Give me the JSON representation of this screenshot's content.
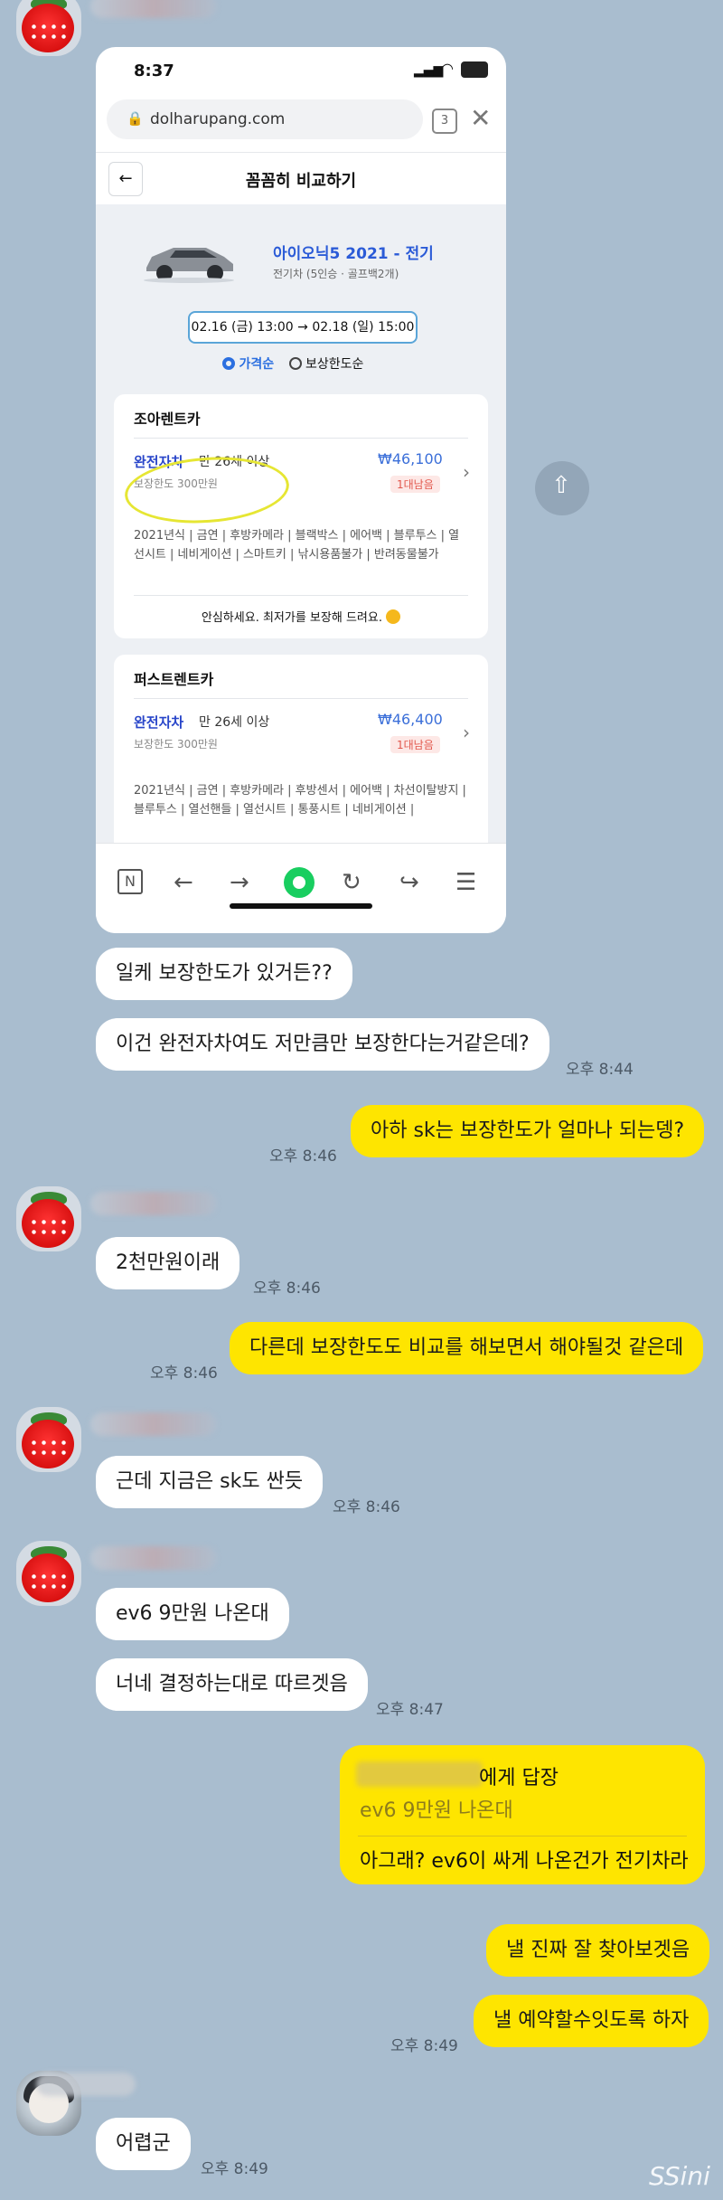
{
  "phone": {
    "status_time": "8:37",
    "tab_count": "3",
    "url": "dolharupang.com",
    "page_title": "꼼꼼히 비교하기",
    "car_name": "아이오닉5 2021 - 전기",
    "car_specs": "전기차 (5인승 · 골프백2개)",
    "date_from": "02.16 (금) 13:00",
    "date_arrow": "→",
    "date_to": "02.18 (일) 15:00",
    "sort_price": "가격순",
    "sort_coverage": "보상한도순",
    "companies": [
      {
        "name": "조아렌트카",
        "insurance": "완전자차",
        "age": "만 26세 이상",
        "price": "₩46,100",
        "badge": "1대남음",
        "limit": "보장한도 300만원",
        "options": "2021년식 | 금연 | 후방카메라 | 블랙박스 | 에어백 | 블루투스 | 열선시트 | 네비게이션 | 스마트키 | 낚시용품불가 | 반려동물불가",
        "notice": "안심하세요. 최저가를 보장해 드려요."
      },
      {
        "name": "퍼스트렌트카",
        "insurance": "완전자차",
        "age": "만 26세 이상",
        "price": "₩46,400",
        "badge": "1대남음",
        "limit": "보장한도 300만원",
        "options": "2021년식 | 금연 | 후방카메라 | 후방센서 | 에어백 | 차선이탈방지 | 블루투스 | 열선핸들 | 열선시트 | 통풍시트 | 네비게이션 |"
      }
    ]
  },
  "messages": [
    {
      "side": "left",
      "text": "일케 보장한도가 있거든??"
    },
    {
      "side": "left",
      "text": "이건 완전자차여도 저만큼만 보장한다는거같은데?",
      "time": "오후 8:44"
    },
    {
      "side": "right",
      "text": "아하 sk는 보장한도가 얼마나 되는뎅?",
      "time": "오후 8:46"
    },
    {
      "side": "left",
      "text": "2천만원이래",
      "time": "오후 8:46"
    },
    {
      "side": "right",
      "text": "다른데 보장한도도 비교를 해보면서  해야될것 같은데",
      "time": "오후 8:46"
    },
    {
      "side": "left",
      "text": "근데 지금은 sk도 싼듯",
      "time": "오후 8:46"
    },
    {
      "side": "left",
      "text": "ev6 9만원 나온대"
    },
    {
      "side": "left",
      "text": "너네 결정하는대로 따르겟음",
      "time": "오후 8:47"
    },
    {
      "side": "right",
      "reply_header": "에게 답장",
      "reply_quote": "ev6 9만원 나온대",
      "text": "아그래? ev6이 싸게 나온건가 전기차라"
    },
    {
      "side": "right",
      "text": "낼 진짜 잘 찾아보겟음"
    },
    {
      "side": "right",
      "text": "낼 예약할수잇도록 하자",
      "time": "오후 8:49"
    },
    {
      "side": "left",
      "text": "어렵군",
      "time": "오후 8:49"
    }
  ],
  "watermark": "SSini",
  "colors": {
    "background": "#a9bdcf",
    "my_bubble": "#fee500",
    "their_bubble": "#ffffff",
    "price_blue": "#3b6fd9",
    "badge_red": "#e2574c"
  }
}
